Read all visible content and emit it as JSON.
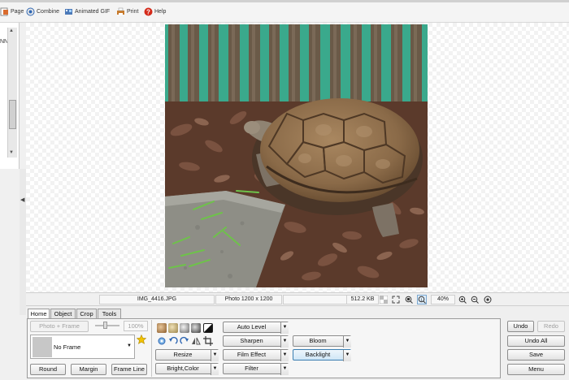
{
  "menu": {
    "page": "Page",
    "combine": "Combine",
    "animated_gif": "Animated GIF",
    "print": "Print",
    "help": "Help"
  },
  "left_fragment": "NNL",
  "status": {
    "filename": "IMG_4416.JPG",
    "dimensions": "Photo 1200 x 1200",
    "filesize": "512.2 KB",
    "zoom": "40%"
  },
  "tabs": [
    "Home",
    "Object",
    "Crop",
    "Tools"
  ],
  "home": {
    "photo_frame": "Photo + Frame",
    "percent": "100%",
    "frame_name": "No Frame",
    "round": "Round",
    "margin": "Margin",
    "frame_line": "Frame Line",
    "auto_level": "Auto Level",
    "sharpen": "Sharpen",
    "film_effect": "Film Effect",
    "filter": "Filter",
    "resize": "Resize",
    "bright_color": "Bright,Color",
    "bloom": "Bloom",
    "backlight": "Backlight"
  },
  "actions": {
    "undo": "Undo",
    "redo": "Redo",
    "undo_all": "Undo All",
    "save": "Save",
    "menu": "Menu"
  },
  "colors": {
    "fence_teal": "#3aa98c",
    "help_red": "#d42a1a",
    "star_yellow": "#f2c200",
    "selected_blue": "#3c7fb1"
  }
}
